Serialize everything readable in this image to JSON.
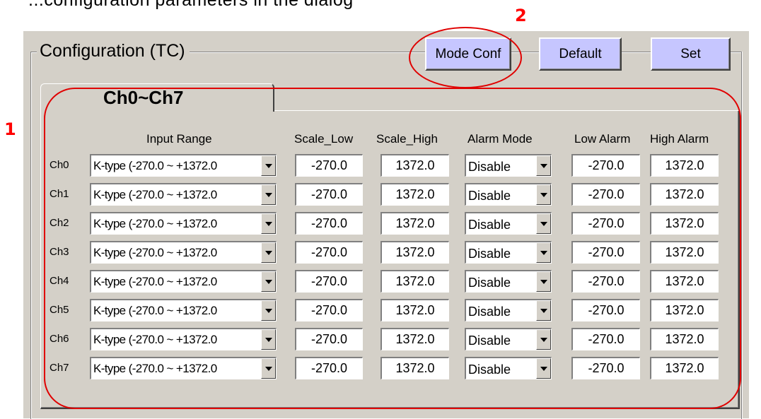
{
  "top_text": "...configuration parameters in the dialog",
  "annotations": {
    "marker_1": "1",
    "marker_2": "2"
  },
  "colors": {
    "button_bg": "#c6c6ff",
    "dialog_bg": "#d4d0c8",
    "highlight": "#e00000"
  },
  "group": {
    "title": "Configuration (TC)"
  },
  "buttons": {
    "mode_conf": "Mode Conf",
    "default": "Default",
    "set": "Set"
  },
  "tab": {
    "label": "Ch0~Ch7"
  },
  "headers": {
    "input_range": "Input Range",
    "scale_low": "Scale_Low",
    "scale_high": "Scale_High",
    "alarm_mode": "Alarm Mode",
    "low_alarm": "Low Alarm",
    "high_alarm": "High Alarm"
  },
  "rows": [
    {
      "channel": "Ch0",
      "input_range": "K-type (-270.0 ~ +1372.0",
      "scale_low": "-270.0",
      "scale_high": "1372.0",
      "alarm_mode": "Disable",
      "low_alarm": "-270.0",
      "high_alarm": "1372.0"
    },
    {
      "channel": "Ch1",
      "input_range": "K-type (-270.0 ~ +1372.0",
      "scale_low": "-270.0",
      "scale_high": "1372.0",
      "alarm_mode": "Disable",
      "low_alarm": "-270.0",
      "high_alarm": "1372.0"
    },
    {
      "channel": "Ch2",
      "input_range": "K-type (-270.0 ~ +1372.0",
      "scale_low": "-270.0",
      "scale_high": "1372.0",
      "alarm_mode": "Disable",
      "low_alarm": "-270.0",
      "high_alarm": "1372.0"
    },
    {
      "channel": "Ch3",
      "input_range": "K-type (-270.0 ~ +1372.0",
      "scale_low": "-270.0",
      "scale_high": "1372.0",
      "alarm_mode": "Disable",
      "low_alarm": "-270.0",
      "high_alarm": "1372.0"
    },
    {
      "channel": "Ch4",
      "input_range": "K-type (-270.0 ~ +1372.0",
      "scale_low": "-270.0",
      "scale_high": "1372.0",
      "alarm_mode": "Disable",
      "low_alarm": "-270.0",
      "high_alarm": "1372.0"
    },
    {
      "channel": "Ch5",
      "input_range": "K-type (-270.0 ~ +1372.0",
      "scale_low": "-270.0",
      "scale_high": "1372.0",
      "alarm_mode": "Disable",
      "low_alarm": "-270.0",
      "high_alarm": "1372.0"
    },
    {
      "channel": "Ch6",
      "input_range": "K-type (-270.0 ~ +1372.0",
      "scale_low": "-270.0",
      "scale_high": "1372.0",
      "alarm_mode": "Disable",
      "low_alarm": "-270.0",
      "high_alarm": "1372.0"
    },
    {
      "channel": "Ch7",
      "input_range": "K-type (-270.0 ~ +1372.0",
      "scale_low": "-270.0",
      "scale_high": "1372.0",
      "alarm_mode": "Disable",
      "low_alarm": "-270.0",
      "high_alarm": "1372.0"
    }
  ]
}
